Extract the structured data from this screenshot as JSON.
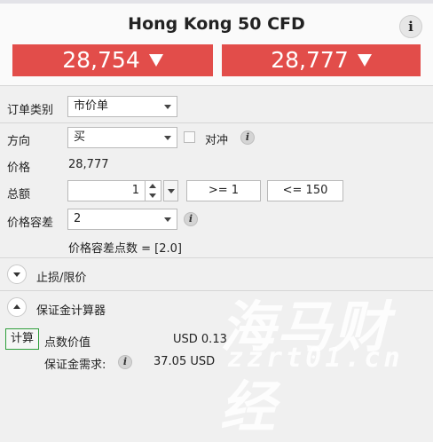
{
  "header": {
    "title": "Hong Kong 50 CFD",
    "info_label": "i",
    "sell_price": "28,754",
    "buy_price": "28,777"
  },
  "form": {
    "order_type_label": "订单类别",
    "order_type_value": "市价单",
    "direction_label": "方向",
    "direction_value": "买",
    "hedge_label": "对冲",
    "hedge_checked": false,
    "price_label": "价格",
    "price_value": "28,777",
    "amount_label": "总额",
    "amount_value": "1",
    "amount_min_chip": ">= 1",
    "amount_max_chip": "<= 150",
    "tolerance_label": "价格容差",
    "tolerance_value": "2",
    "tolerance_points_text": "价格容差点数 = [2.0]"
  },
  "sections": {
    "stop_limit_label": "止损/限价",
    "margin_calc_label": "保证金计算器"
  },
  "calculator": {
    "calc_button_label": "计算",
    "point_value_label": "点数价值",
    "point_value": "USD 0.13",
    "margin_req_label": "保证金需求:",
    "margin_req_value": "37.05 USD"
  },
  "watermark": {
    "brand_text": "海马财经",
    "url_text": "zzrt01.cn"
  },
  "icons": {
    "info": "info-icon",
    "dropdown": "chevron-down-icon",
    "expand": "expand-icon",
    "collapse": "collapse-icon"
  },
  "colors": {
    "price_button": "#e24d4a",
    "calc_border": "#2e9e3a"
  }
}
